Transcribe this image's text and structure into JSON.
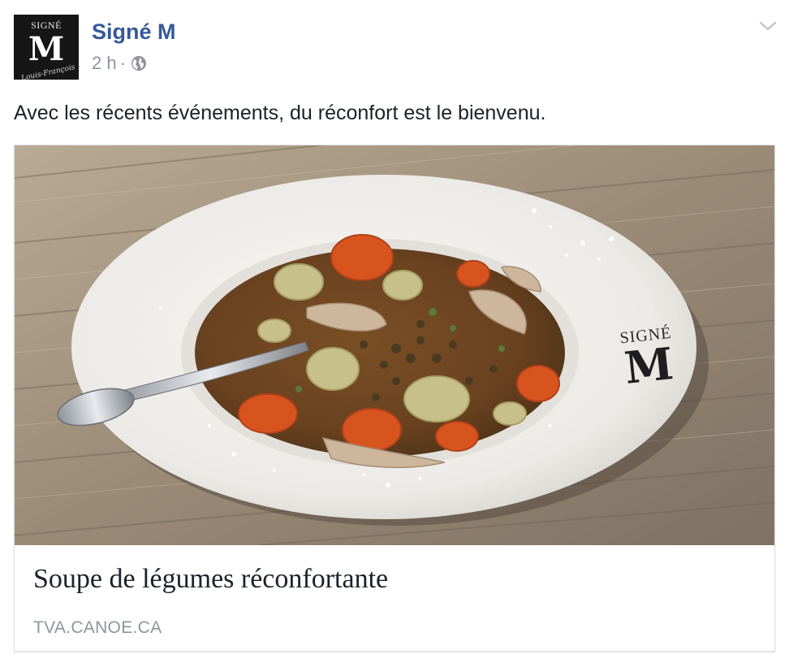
{
  "post": {
    "page_name": "Signé M",
    "timestamp": "2 h",
    "separator": "·",
    "privacy_icon": "globe-icon",
    "options_icon": "chevron-down-icon",
    "message": "Avec les récents événements, du réconfort est le bienvenu.",
    "avatar": {
      "logo_top": "SIGNÉ",
      "logo_letter": "M",
      "logo_signature": "Louis-François"
    }
  },
  "link_preview": {
    "image_alt": "Bol de soupe aux légumes avec cuillère sur une table en bois",
    "plate_logo_top": "SIGNÉ",
    "plate_logo_letter": "M",
    "title": "Soupe de légumes réconfortante",
    "domain": "TVA.CANOE.CA"
  },
  "colors": {
    "link_blue": "#365899",
    "meta_gray": "#90949c",
    "text": "#1d2129",
    "card_border": "#dddfe2"
  }
}
